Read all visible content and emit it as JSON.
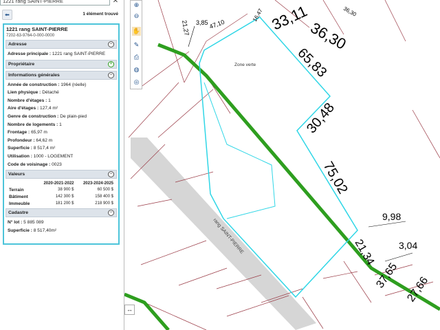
{
  "search": {
    "value": "1221 rang SAINT-PIERRE"
  },
  "result_count": "1 élément trouvé",
  "property": {
    "title": "1221 rang SAINT-PIERRE",
    "id": "7202-63-9764-0-000-0000"
  },
  "sections": {
    "adresse": {
      "title": "Adresse",
      "label": "Adresse principale :",
      "value": "1221 rang SAINT-PIERRE"
    },
    "proprietaire": {
      "title": "Propriétaire"
    },
    "infos": {
      "title": "Informations générales",
      "rows": [
        {
          "label": "Année de construction :",
          "value": "1964 (réelle)"
        },
        {
          "label": "Lien physique :",
          "value": "Détaché"
        },
        {
          "label": "Nombre d'étages :",
          "value": "1"
        },
        {
          "label": "Aire d'étages :",
          "value": "127,4 m²"
        },
        {
          "label": "Genre de construction :",
          "value": "De plain-pied"
        },
        {
          "label": "Nombre de logements :",
          "value": "1"
        },
        {
          "label": "Frontage :",
          "value": "65,97 m"
        },
        {
          "label": "Profondeur :",
          "value": "64,62 m"
        },
        {
          "label": "Superficie :",
          "value": "8 517,4 m²"
        },
        {
          "label": "Utilisation :",
          "value": "1000 - LOGEMENT"
        },
        {
          "label": "Code de voisinage :",
          "value": "0023"
        }
      ]
    },
    "valeurs": {
      "title": "Valeurs",
      "columns": [
        "2020-2021-2022",
        "2023-2024-2025"
      ],
      "rows": [
        {
          "label": "Terrain",
          "a": "38 900 $",
          "b": "60 500 $"
        },
        {
          "label": "Bâtiment",
          "a": "142 300 $",
          "b": "158 400 $"
        },
        {
          "label": "Immeuble",
          "a": "181 200 $",
          "b": "218 900 $"
        }
      ]
    },
    "cadastre": {
      "title": "Cadastre",
      "rows": [
        {
          "label": "N° lot :",
          "value": "5 885 089"
        },
        {
          "label": "Superficie :",
          "value": "8 517,40m²"
        }
      ]
    }
  },
  "map": {
    "zone_label": "Zone verte",
    "road_label": "rang SAINT-PIERRE",
    "dims": [
      "3,85",
      "47,10",
      "16,47",
      "33,11",
      "36,30",
      "21,27",
      "65,83",
      "30,48",
      "75,02",
      "9,98",
      "3,04",
      "21,34",
      "37,65",
      "27,66",
      "36,30"
    ],
    "colors": {
      "zone": "#2e9e1f",
      "selection": "#2fd6e6",
      "road": "#d2d2d2",
      "lot_line": "#9a3b46"
    }
  }
}
